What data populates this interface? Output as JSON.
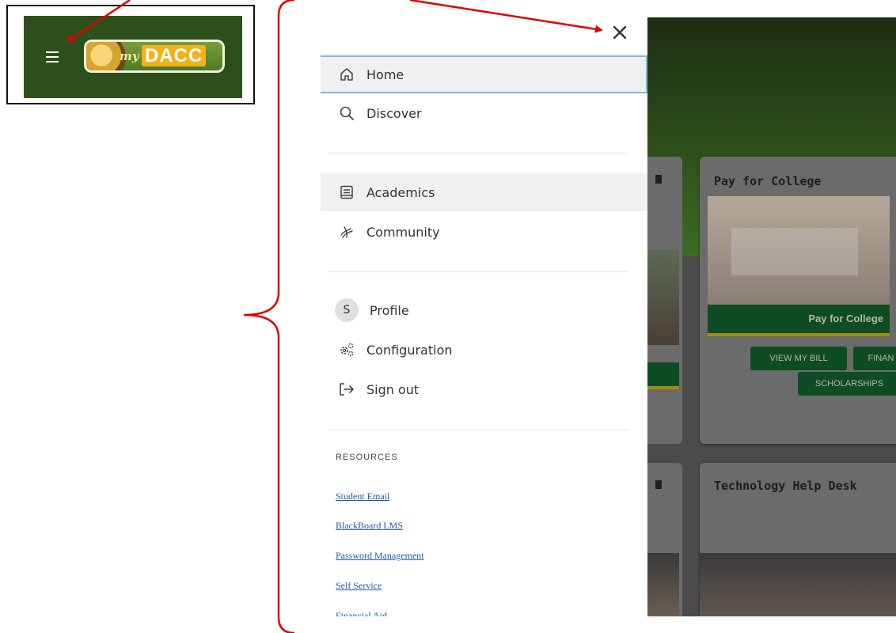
{
  "inset": {
    "logo_prefix": "my",
    "logo_name": "DACC"
  },
  "drawer": {
    "nav": [
      {
        "label": "Home",
        "icon": "home-icon"
      },
      {
        "label": "Discover",
        "icon": "search-icon"
      },
      {
        "label": "Academics",
        "icon": "book-icon"
      },
      {
        "label": "Community",
        "icon": "community-icon"
      }
    ],
    "account": {
      "avatar_initial": "S",
      "items": [
        {
          "label": "Profile"
        },
        {
          "label": "Configuration",
          "icon": "gears-icon"
        },
        {
          "label": "Sign out",
          "icon": "sign-out-icon"
        }
      ]
    },
    "resources": {
      "heading": "RESOURCES",
      "links": [
        "Student Email",
        "BlackBoard LMS",
        "Password Management",
        "Self Service",
        "Financial Aid"
      ]
    }
  },
  "background": {
    "cards": [
      {
        "title": "Pay for College",
        "banner": "Pay for College",
        "buttons": [
          "VIEW MY BILL",
          "FINAN",
          "SCHOLARSHIPS"
        ]
      },
      {
        "title": "Technology Help Desk"
      }
    ]
  },
  "colors": {
    "brand_green": "#2d4f1c",
    "brand_gold": "#f1b21b",
    "annotation_red": "#e00000",
    "link_blue": "#1f5aa8"
  }
}
